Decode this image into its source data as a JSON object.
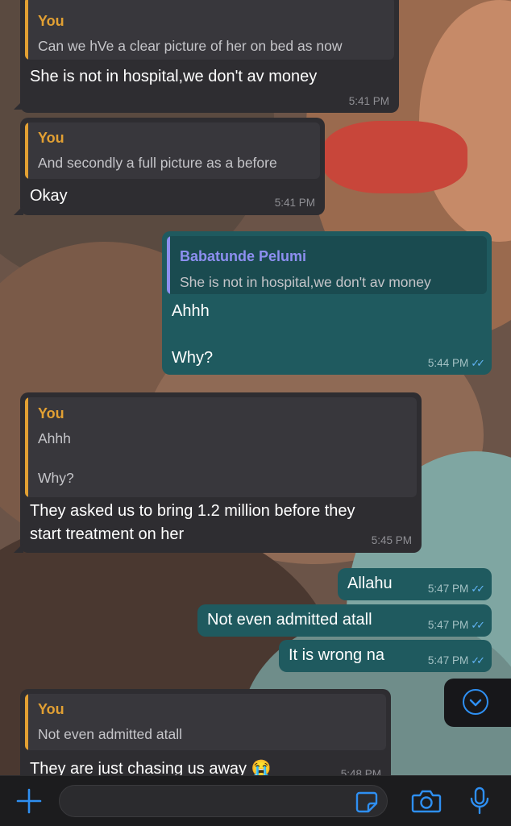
{
  "messages": [
    {
      "direction": "in",
      "quote_author": "You",
      "quote_text": "Can we hVe a clear picture of her on bed as now",
      "text": "She is not in hospital,we don't av money",
      "time": "5:41 PM"
    },
    {
      "direction": "in",
      "quote_author": "You",
      "quote_text": "And secondly a full picture as a before",
      "text": "Okay",
      "time": "5:41 PM"
    },
    {
      "direction": "out",
      "quote_author": "Babatunde Pelumi",
      "quote_text": "She is not in hospital,we don't av money",
      "text_line1": "Ahhh",
      "text_line2": "Why?",
      "time": "5:44 PM",
      "status": "read"
    },
    {
      "direction": "in",
      "quote_author": "You",
      "quote_line1": "Ahhh",
      "quote_line2": "Why?",
      "text_line1": "They asked us to bring 1.2 million before they",
      "text_line2": "start treatment on her",
      "time": "5:45 PM"
    },
    {
      "direction": "out",
      "text": "Allahu",
      "time": "5:47 PM",
      "status": "read"
    },
    {
      "direction": "out",
      "text": "Not even admitted atall",
      "time": "5:47 PM",
      "status": "read"
    },
    {
      "direction": "out",
      "text": "It is wrong na",
      "time": "5:47 PM",
      "status": "read"
    },
    {
      "direction": "in",
      "quote_author": "You",
      "quote_text": "Not even admitted atall",
      "text": "They are just chasing us away 😭",
      "time": "5:48 PM"
    }
  ],
  "input": {
    "placeholder": "",
    "value": ""
  },
  "icons": {
    "attach": "plus-icon",
    "sticker": "sticker-icon",
    "camera": "camera-icon",
    "microphone": "microphone-icon",
    "scroll_down": "chevron-down-icon",
    "read_receipt": "double-check-icon"
  },
  "colors": {
    "incoming_bubble": "#2e2d31",
    "outgoing_bubble": "#1f5a5f",
    "self_quote_author": "#e2a033",
    "other_quote_author": "#8d8ff0",
    "accent": "#2e8ff2",
    "read_receipt": "#61b3f5"
  }
}
